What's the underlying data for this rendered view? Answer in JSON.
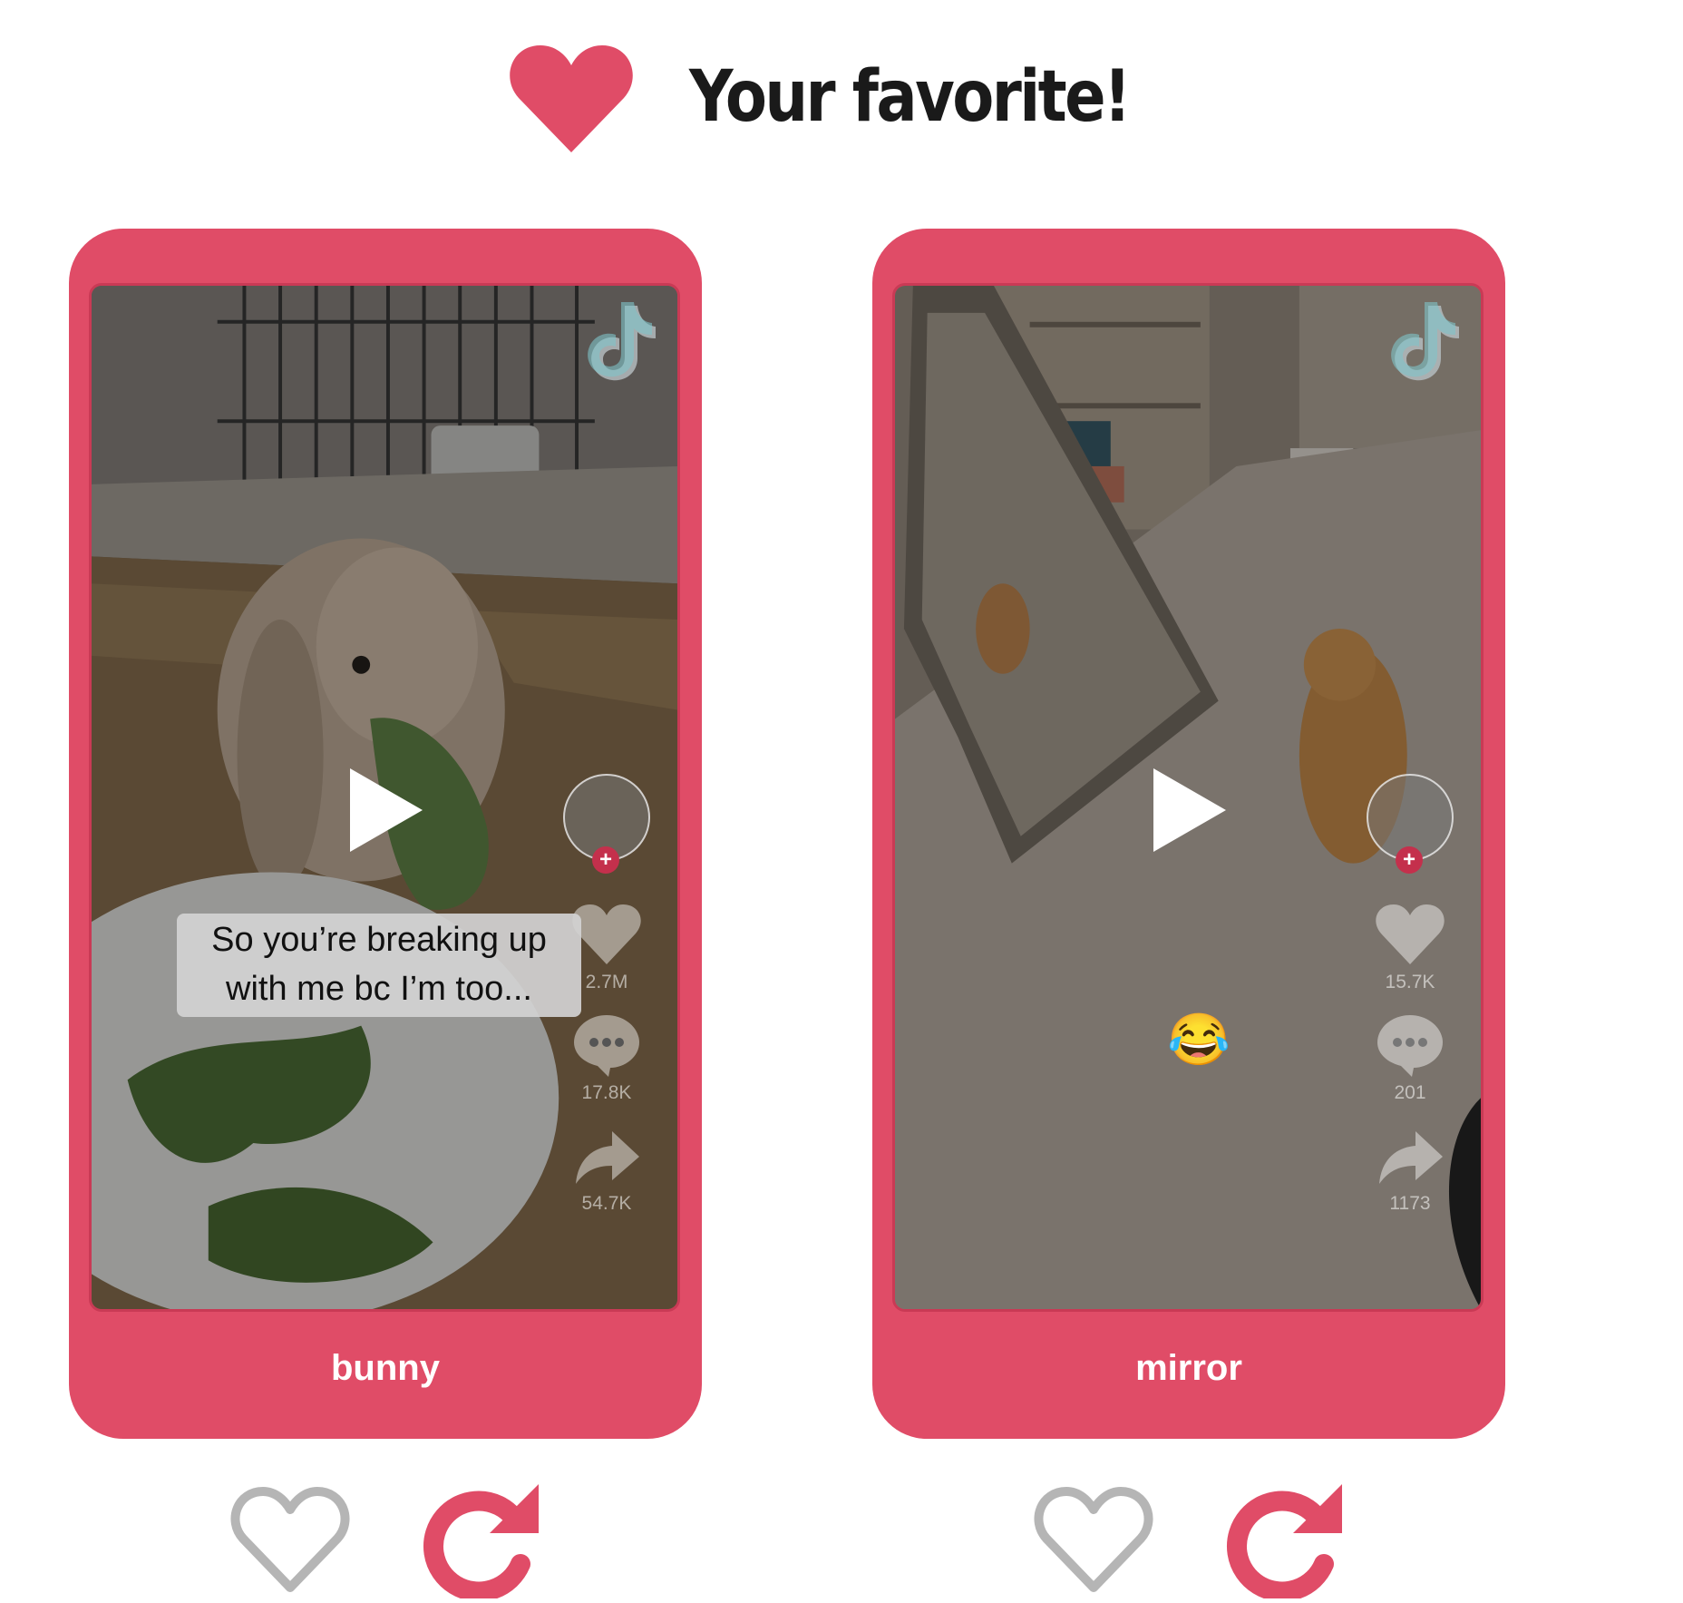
{
  "header": {
    "title": "Your favorite!",
    "icon": "heart-icon"
  },
  "colors": {
    "accent": "#e04c67",
    "outline_heart": "#b5b5b5",
    "text": "#1a1a1a"
  },
  "videos": [
    {
      "label": "bunny",
      "caption_line1": "So you’re breaking up",
      "caption_line2": "with me bc I’m too...",
      "likes": "2.7M",
      "comments": "17.8K",
      "shares": "54.7K"
    },
    {
      "label": "mirror",
      "emoji": "😂",
      "likes": "15.7K",
      "comments": "201",
      "shares": "1173"
    }
  ],
  "actions": {
    "like_icon": "heart-outline-icon",
    "replay_icon": "replay-icon"
  }
}
